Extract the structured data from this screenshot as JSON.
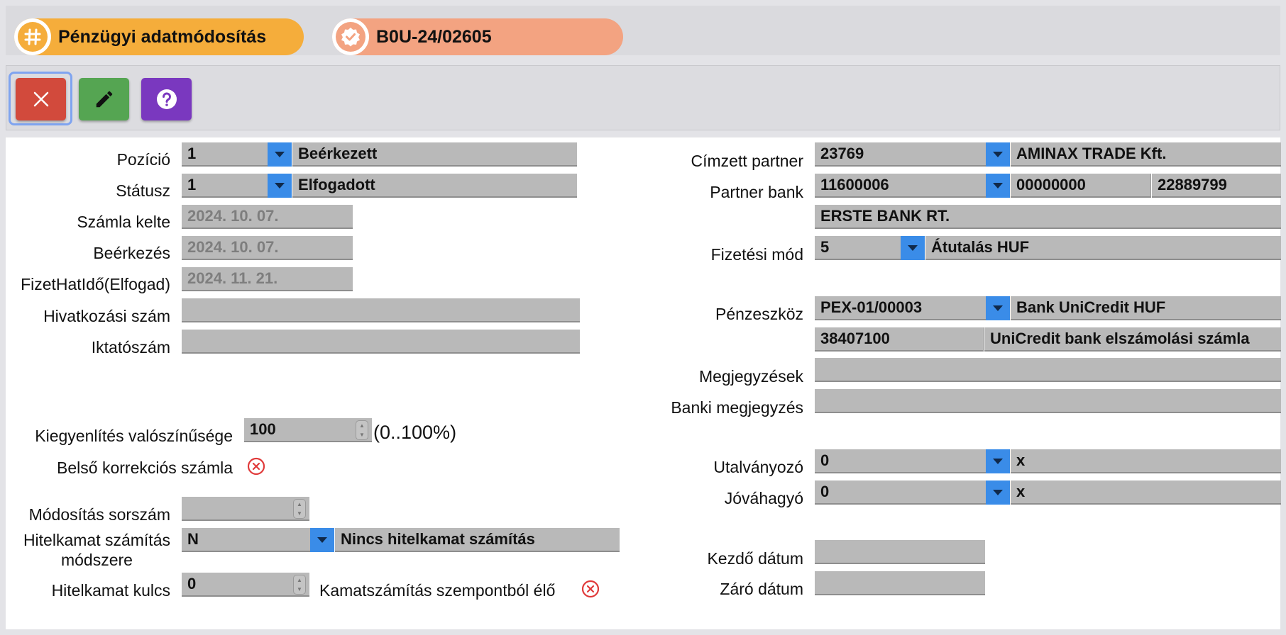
{
  "header": {
    "title": "Pénzügyi adatmódosítás",
    "doc_id": "B0U-24/02605",
    "title_color": "#f5ad3b",
    "doc_color": "#f3a381"
  },
  "toolbar": {
    "close_color": "#d24a3c",
    "edit_color": "#55a552",
    "help_color": "#7a38bf"
  },
  "left": {
    "pozicio": {
      "label": "Pozíció",
      "code": "1",
      "text": "Beérkezett"
    },
    "statusz": {
      "label": "Státusz",
      "code": "1",
      "text": "Elfogadott"
    },
    "szamla_kelte": {
      "label": "Számla kelte",
      "value": "2024. 10. 07."
    },
    "beerkezes": {
      "label": "Beérkezés",
      "value": "2024. 10. 07."
    },
    "fizet_hatido": {
      "label": "FizetHatIdő(Elfogad)",
      "value": "2024. 11. 21."
    },
    "hivatkozasi_szam": {
      "label": "Hivatkozási szám",
      "value": ""
    },
    "iktatoszam": {
      "label": "Iktatószám",
      "value": ""
    },
    "kiegyenlites": {
      "label": "Kiegyenlítés valószínűsége",
      "value": "100",
      "range": "(0..100%)"
    },
    "belso_korrekcios": {
      "label": "Belső korrekciós számla"
    },
    "modositas_sorszam": {
      "label": "Módosítás sorszám",
      "value": ""
    },
    "hitelkamat_modszer": {
      "label_line1": "Hitelkamat számítás",
      "label_line2": "módszere",
      "code": "N",
      "text": "Nincs hitelkamat számítás"
    },
    "hitelkamat_kulcs": {
      "label": "Hitelkamat kulcs",
      "value": "0"
    },
    "kamatszamitas": {
      "label": "Kamatszámítás szempontból élő"
    }
  },
  "right": {
    "cimzett_partner": {
      "label": "Címzett partner",
      "code": "23769",
      "text": "AMINAX TRADE Kft."
    },
    "partner_bank": {
      "label": "Partner bank",
      "part1": "11600006",
      "part2": "00000000",
      "part3": "22889799",
      "bank_name": "ERSTE BANK RT."
    },
    "fizetesi_mod": {
      "label": "Fizetési mód",
      "code": "5",
      "text": "Átutalás HUF"
    },
    "penzeszkoz": {
      "label": "Pénzeszköz",
      "code": "PEX-01/00003",
      "text": "Bank UniCredit HUF",
      "account": "38407100",
      "account_name": "UniCredit bank elszámolási számla"
    },
    "megjegyzesek": {
      "label": "Megjegyzések",
      "value": ""
    },
    "banki_megjegyzes": {
      "label": "Banki megjegyzés",
      "value": ""
    },
    "utalvanyozo": {
      "label": "Utalványozó",
      "code": "0",
      "text": "x"
    },
    "jovahagyo": {
      "label": "Jóváhagyó",
      "code": "0",
      "text": "x"
    },
    "kezdo_datum": {
      "label": "Kezdő dátum",
      "value": ""
    },
    "zaro_datum": {
      "label": "Záró dátum",
      "value": ""
    }
  }
}
